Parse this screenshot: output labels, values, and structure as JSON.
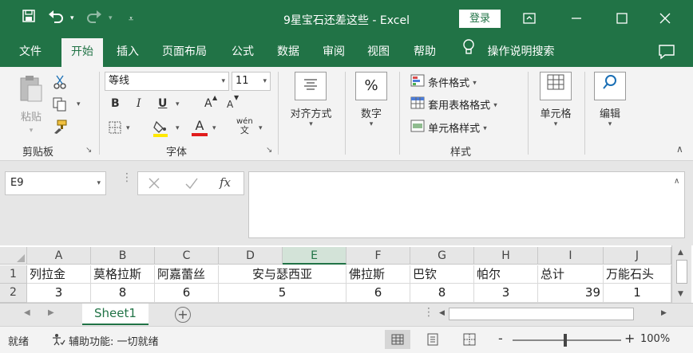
{
  "window": {
    "title": "9星宝石还差这些  -  Excel",
    "login_label": "登录"
  },
  "tabs": [
    {
      "label": "文件"
    },
    {
      "label": "开始"
    },
    {
      "label": "插入"
    },
    {
      "label": "页面布局"
    },
    {
      "label": "公式"
    },
    {
      "label": "数据"
    },
    {
      "label": "审阅"
    },
    {
      "label": "视图"
    },
    {
      "label": "帮助"
    }
  ],
  "tell_me": "操作说明搜索",
  "ribbon": {
    "clipboard": {
      "paste_label": "粘贴",
      "group_label": "剪贴板"
    },
    "font": {
      "name": "等线",
      "size": "11",
      "bold": "B",
      "italic": "I",
      "underline": "U",
      "grow": "A",
      "shrink": "A",
      "font_color": "A",
      "wen": "wén",
      "group_label": "字体"
    },
    "alignment": {
      "label": "对齐方式"
    },
    "number": {
      "label": "数字",
      "icon_text": "%"
    },
    "styles": {
      "conditional": "条件格式",
      "table": "套用表格格式",
      "cell_styles": "单元格样式",
      "group_label": "样式"
    },
    "cells": {
      "label": "单元格"
    },
    "editing": {
      "label": "编辑"
    }
  },
  "formula_bar": {
    "name_box": "E9",
    "fx": "fx",
    "formula": ""
  },
  "grid": {
    "columns": [
      "A",
      "B",
      "C",
      "D",
      "E",
      "F",
      "G",
      "H",
      "I",
      "J"
    ],
    "selected_column": "E",
    "rows": [
      {
        "num": "1",
        "cells": [
          "列拉金",
          "莫格拉斯",
          "阿嘉蕾丝",
          "安与瑟西亚",
          "",
          "佛拉斯",
          "巴钦",
          "帕尔",
          "总计",
          "万能石头"
        ]
      },
      {
        "num": "2",
        "cells": [
          "3",
          "8",
          "6",
          "5",
          "",
          "6",
          "8",
          "3",
          "39",
          "1"
        ]
      }
    ]
  },
  "sheet": {
    "tab": "Sheet1",
    "add": "+"
  },
  "status": {
    "ready": "就绪",
    "accessibility": "辅助功能: 一切就绪",
    "zoom": "100%",
    "minus": "-",
    "plus": "+"
  },
  "colors": {
    "accent": "#217346",
    "font_color_bar": "#e11c1c",
    "highlight_bar": "#ffe800"
  },
  "icons": [
    "save-icon",
    "undo-icon",
    "redo-icon",
    "customize-qat-icon",
    "ribbon-display-icon",
    "minimize-icon",
    "maximize-icon",
    "close-icon",
    "lightbulb-icon",
    "comment-icon",
    "paste-icon",
    "cut-icon",
    "copy-icon",
    "format-painter-icon",
    "border-icon",
    "fill-color-icon",
    "font-color-icon",
    "phonetic-icon",
    "align-icon",
    "conditional-format-icon",
    "format-table-icon",
    "cell-styles-icon",
    "cells-icon",
    "search-icon",
    "cancel-icon",
    "enter-icon",
    "function-icon",
    "expand-icon",
    "scroll-up-icon",
    "scroll-down-icon",
    "sheet-prev-icon",
    "sheet-next-icon",
    "add-sheet-icon",
    "accessibility-icon",
    "normal-view-icon",
    "page-layout-icon",
    "page-break-icon"
  ]
}
